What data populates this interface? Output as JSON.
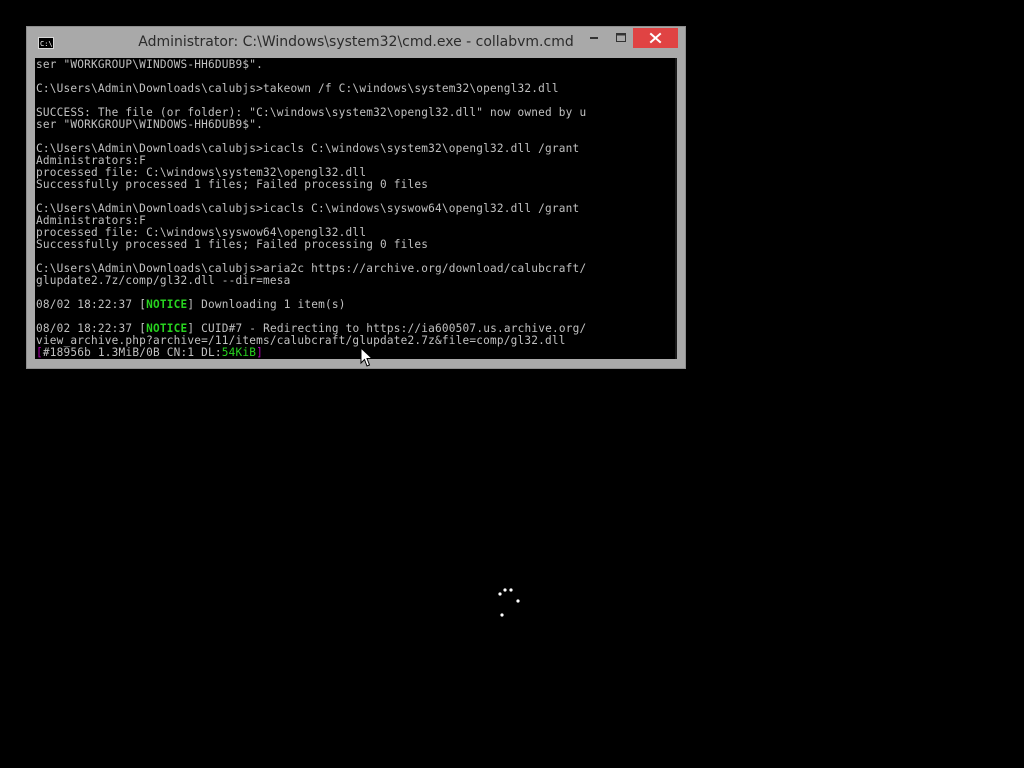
{
  "window": {
    "title": "Administrator: C:\\Windows\\system32\\cmd.exe - collabvm.cmd",
    "icon": "cmd-icon",
    "controls": {
      "minimize": "minimize-icon",
      "maximize": "maximize-icon",
      "close": "close-icon",
      "close_color": "#e04343"
    }
  },
  "console": {
    "lines": [
      "ser \"WORKGROUP\\WINDOWS-HH6DUB9$\".",
      "",
      "C:\\Users\\Admin\\Downloads\\calubjs>takeown /f C:\\windows\\system32\\opengl32.dll",
      "",
      "SUCCESS: The file (or folder): \"C:\\windows\\system32\\opengl32.dll\" now owned by u",
      "ser \"WORKGROUP\\WINDOWS-HH6DUB9$\".",
      "",
      "C:\\Users\\Admin\\Downloads\\calubjs>icacls C:\\windows\\system32\\opengl32.dll /grant",
      "Administrators:F",
      "processed file: C:\\windows\\system32\\opengl32.dll",
      "Successfully processed 1 files; Failed processing 0 files",
      "",
      "C:\\Users\\Admin\\Downloads\\calubjs>icacls C:\\windows\\syswow64\\opengl32.dll /grant",
      "Administrators:F",
      "processed file: C:\\windows\\syswow64\\opengl32.dll",
      "Successfully processed 1 files; Failed processing 0 files",
      "",
      "C:\\Users\\Admin\\Downloads\\calubjs>aria2c https://archive.org/download/calubcraft/",
      "glupdate2.7z/comp/gl32.dll --dir=mesa",
      ""
    ],
    "notice1": {
      "timestamp": "08/02 18:22:37",
      "open": "[",
      "tag": "NOTICE",
      "close": "]",
      "message": "Downloading 1 item(s)"
    },
    "notice2": {
      "timestamp": "08/02 18:22:37",
      "open": "[",
      "tag": "NOTICE",
      "close": "]",
      "message": "CUID#7 - Redirecting to https://ia600507.us.archive.org/",
      "continuation": "view_archive.php?archive=/11/items/calubcraft/glupdate2.7z&file=comp/gl32.dll"
    },
    "progress": {
      "open": "[",
      "stats": "#18956b 1.3MiB/0B CN:1 DL:",
      "speed": "54KiB",
      "close": "]"
    },
    "colors": {
      "text": "#c0c0c0",
      "notice": "#27d21f",
      "bracket": "#b000b0",
      "speed": "#27d21f"
    }
  },
  "desktop": {
    "pointer": "mouse-pointer-icon",
    "spinner": "loading-spinner-icon"
  }
}
